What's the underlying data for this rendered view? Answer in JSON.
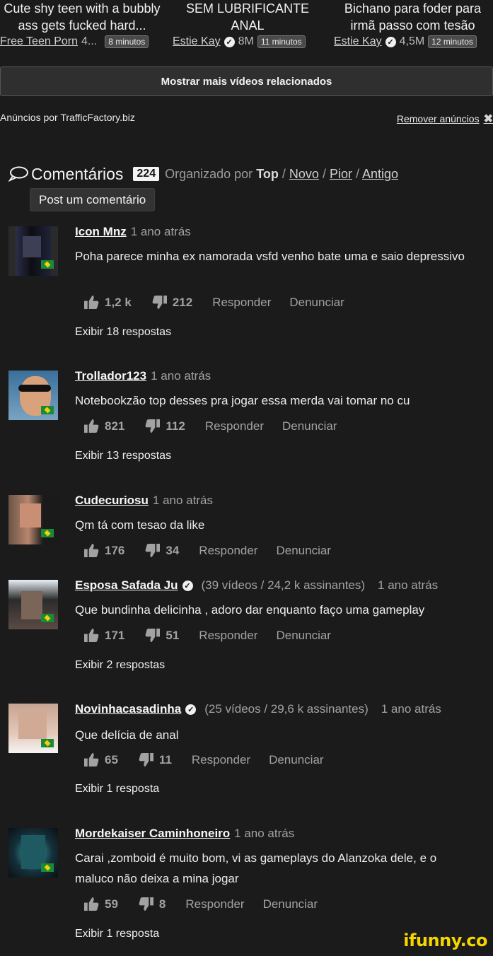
{
  "related_videos": [
    {
      "title_line1": "Cute shy teen with a bubbly",
      "title_line2": "ass gets fucked hard...",
      "channel": "Free Teen Porn",
      "views": "4...",
      "duration": "8 minutos",
      "verified": false
    },
    {
      "title_line1": "SEM LUBRIFICANTE",
      "title_line2": "ANAL",
      "channel": "Estie Kay",
      "views": "8M",
      "duration": "11 minutos",
      "verified": true
    },
    {
      "title_line1": "Bichano para foder para",
      "title_line2": "irmã passo com tesão",
      "channel": "Estie Kay",
      "views": "4,5M",
      "duration": "12 minutos",
      "verified": true
    }
  ],
  "more_button": "Mostrar mais vídeos relacionados",
  "ads": {
    "by": "Anúncios por TrafficFactory.biz",
    "remove": "Remover anúncios"
  },
  "comments_header": {
    "title": "Comentários",
    "count": "224",
    "sort_label": "Organizado por",
    "sort_active": "Top",
    "sort_options": [
      "Novo",
      "Pior",
      "Antigo"
    ],
    "separator": "/",
    "post_button": "Post um comentário"
  },
  "actions": {
    "reply": "Responder",
    "report": "Denunciar"
  },
  "comments": [
    {
      "author": "Icon Mnz",
      "time": "1 ano atrás",
      "text": "Poha parece minha ex namorada vsfd venho bate uma e saio depressivo",
      "likes": "1,2 k",
      "dislikes": "212",
      "replies": "Exibir 18 respostas"
    },
    {
      "author": "Trollador123",
      "time": "1 ano atrás",
      "text": "Notebookzão top desses pra jogar essa merda vai tomar no cu",
      "likes": "821",
      "dislikes": "112",
      "replies": "Exibir 13 respostas"
    },
    {
      "author": "Cudecuriosu",
      "time": "1 ano atrás",
      "text": "Qm tá com tesao da like",
      "likes": "176",
      "dislikes": "34",
      "replies": ""
    },
    {
      "author": "Esposa Safada Ju",
      "verified": true,
      "stats": "(39 vídeos / 24,2 k assinantes)",
      "time": "1 ano atrás",
      "text": "Que bundinha delicinha , adoro dar enquanto faço uma gameplay",
      "likes": "171",
      "dislikes": "51",
      "replies": "Exibir 2 respostas"
    },
    {
      "author": "Novinhacasadinha",
      "verified": true,
      "stats": "(25 vídeos / 29,6 k assinantes)",
      "time": "1 ano atrás",
      "text": "Que delícia de anal",
      "likes": "65",
      "dislikes": "11",
      "replies": "Exibir 1 resposta"
    },
    {
      "author": "Mordekaiser Caminhoneiro",
      "time": "1 ano atrás",
      "text": "Carai ,zomboid é muito bom, vi as gameplays do Alanzoka dele, e o maluco não deixa a mina jogar",
      "likes": "59",
      "dislikes": "8",
      "replies": "Exibir 1 resposta"
    }
  ],
  "watermark": "ifunny.co"
}
